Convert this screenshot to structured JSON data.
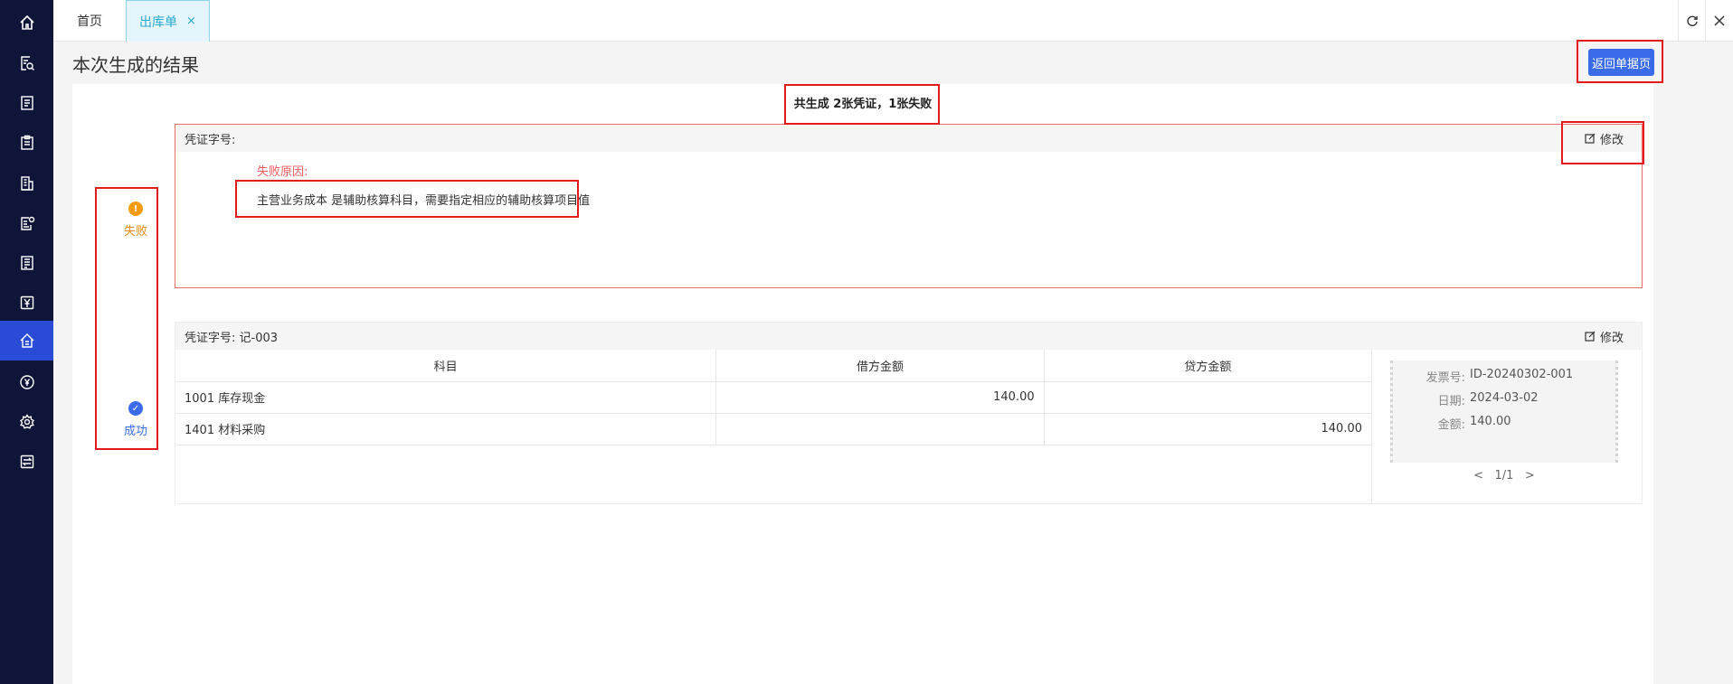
{
  "sidebar": {
    "items": [
      {
        "icon": "home-icon"
      },
      {
        "icon": "doc-search-icon"
      },
      {
        "icon": "list-doc-icon"
      },
      {
        "icon": "clipboard-icon"
      },
      {
        "icon": "building-icon"
      },
      {
        "icon": "doc-settings-icon"
      },
      {
        "icon": "receipt-icon"
      },
      {
        "icon": "yen-doc-icon"
      },
      {
        "icon": "house-finance-icon",
        "active": true
      },
      {
        "icon": "yen-circle-icon"
      },
      {
        "icon": "gear-icon"
      },
      {
        "icon": "transfer-icon"
      }
    ],
    "colors": {
      "background": "#0f1538",
      "active": "#2a4bd6"
    }
  },
  "tabs": {
    "home": "首页",
    "active": "出库单",
    "close": "×"
  },
  "toolbar": {
    "refresh_icon": "refresh-icon",
    "close_icon": "close-icon"
  },
  "page": {
    "title": "本次生成的结果",
    "back_button": "返回单据页"
  },
  "summary": "共生成 2张凭证，1张失败",
  "steps": {
    "fail": {
      "badge": "!",
      "label": "失败"
    },
    "success": {
      "badge": "✓",
      "label": "成功"
    }
  },
  "fail_card": {
    "header": "凭证字号:",
    "edit": "修改",
    "reason_title": "失败原因:",
    "reason": "主营业务成本 是辅助核算科目，需要指定相应的辅助核算项目值"
  },
  "success_card": {
    "header": "凭证字号: 记-003",
    "edit": "修改",
    "columns": [
      "科目",
      "借方金额",
      "贷方金额"
    ],
    "rows": [
      {
        "subject": "1001 库存现金",
        "debit": "140.00",
        "credit": ""
      },
      {
        "subject": "1401 材料采购",
        "debit": "",
        "credit": "140.00"
      }
    ],
    "invoice": {
      "number_label": "发票号:",
      "number": "ID-20240302-001",
      "date_label": "日期:",
      "date": "2024-03-02",
      "amount_label": "金额:",
      "amount": "140.00"
    },
    "pager": {
      "prev": "<",
      "page": "1/1",
      "next": ">"
    }
  },
  "colors": {
    "accent": "#3a6be8",
    "fail": "#ef5b5b",
    "warning": "#f39c12",
    "annotation": "#e31b1b"
  }
}
